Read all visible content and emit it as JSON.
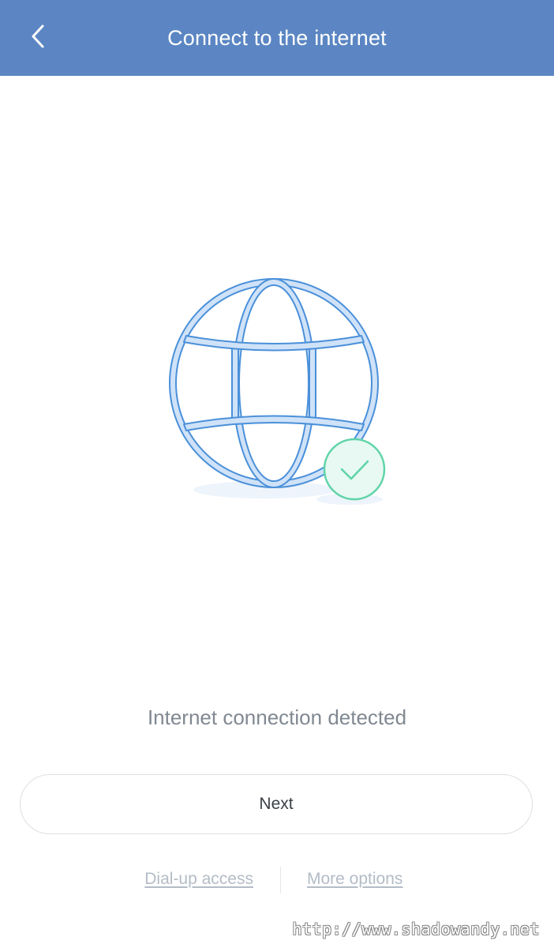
{
  "header": {
    "title": "Connect to the internet",
    "back_icon": "chevron-left-icon",
    "background_color": "#5b86c3"
  },
  "illustration": {
    "globe_icon": "globe-icon",
    "check_icon": "check-circle-icon",
    "globe_color": "#4a90d9",
    "check_color": "#5fd4a8"
  },
  "status": {
    "text": "Internet connection detected"
  },
  "actions": {
    "next_label": "Next",
    "dialup_label": "Dial-up access",
    "more_options_label": "More options"
  },
  "watermark": {
    "text": "http://www.shadowandy.net"
  }
}
